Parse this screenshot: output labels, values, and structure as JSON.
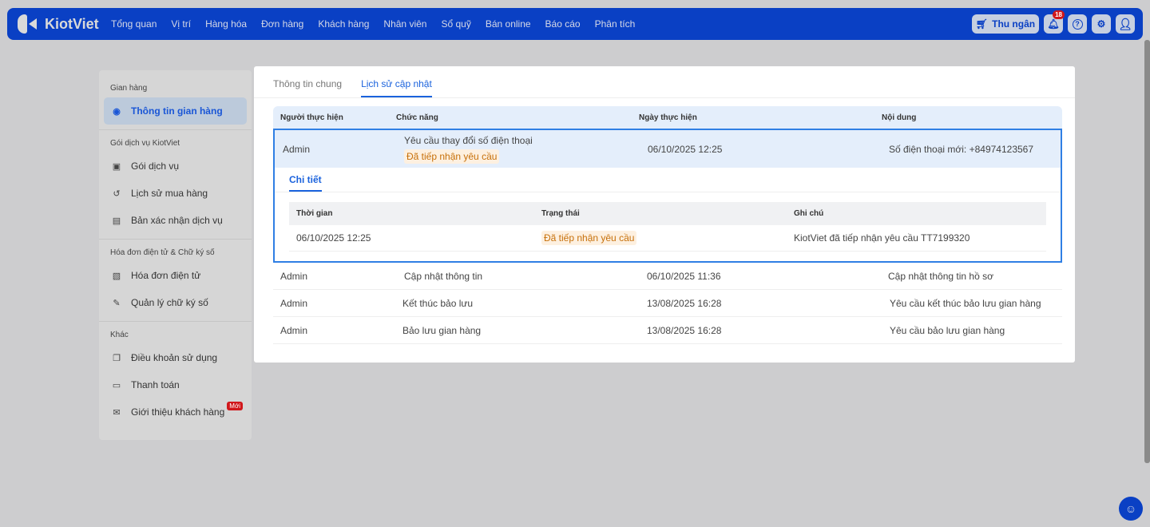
{
  "nav": {
    "brand": "KiotViet",
    "menu": [
      "Tổng quan",
      "Vị trí",
      "Hàng hóa",
      "Đơn hàng",
      "Khách hàng",
      "Nhân viên",
      "Sổ quỹ",
      "Bán online",
      "Báo cáo",
      "Phân tích"
    ],
    "cashier": "Thu ngân",
    "notif_count": "18"
  },
  "sidebar": {
    "sections": [
      {
        "title": "Gian hàng",
        "items": [
          {
            "label": "Thông tin gian hàng"
          }
        ]
      },
      {
        "title": "Gói dịch vụ KiotViet",
        "items": [
          {
            "label": "Gói dịch vụ"
          },
          {
            "label": "Lịch sử mua hàng"
          },
          {
            "label": "Bản xác nhận dịch vụ"
          }
        ]
      },
      {
        "title": "Hóa đơn điện tử & Chữ ký số",
        "items": [
          {
            "label": "Hóa đơn điện tử"
          },
          {
            "label": "Quản lý chữ ký số"
          }
        ]
      },
      {
        "title": "Khác",
        "items": [
          {
            "label": "Điều khoản sử dụng"
          },
          {
            "label": "Thanh toán"
          },
          {
            "label": "Giới thiệu khách hàng",
            "badge": "Mới"
          }
        ]
      }
    ]
  },
  "main": {
    "tabs": [
      "Thông tin chung",
      "Lịch sử cập nhật"
    ],
    "columns": [
      "Người thực hiện",
      "Chức năng",
      "Ngày thực hiện",
      "Nội dung"
    ],
    "expanded": {
      "user": "Admin",
      "function": "Yêu cầu thay đổi số điện thoại",
      "status": "Đã tiếp nhận yêu cầu",
      "date": "06/10/2025 12:25",
      "content": "Số điện thoại mới: +84974123567",
      "detail_tab": "Chi tiết",
      "detail_columns": [
        "Thời gian",
        "Trạng thái",
        "Ghi chú"
      ],
      "detail_row": {
        "time": "06/10/2025 12:25",
        "status": "Đã tiếp nhận yêu cầu",
        "note": "KiotViet đã tiếp nhận yêu cầu TT7199320"
      }
    },
    "rows": [
      {
        "user": "Admin",
        "function": "Cập nhật thông tin",
        "date": "06/10/2025 11:36",
        "content": "Cập nhật thông tin hồ sơ"
      },
      {
        "user": "Admin",
        "function": "Kết thúc bảo lưu",
        "date": "13/08/2025 16:28",
        "content": "Yêu cầu kết thúc bảo lưu gian hàng"
      },
      {
        "user": "Admin",
        "function": "Bảo lưu gian hàng",
        "date": "13/08/2025 16:28",
        "content": "Yêu cầu bảo lưu gian hàng"
      }
    ]
  }
}
